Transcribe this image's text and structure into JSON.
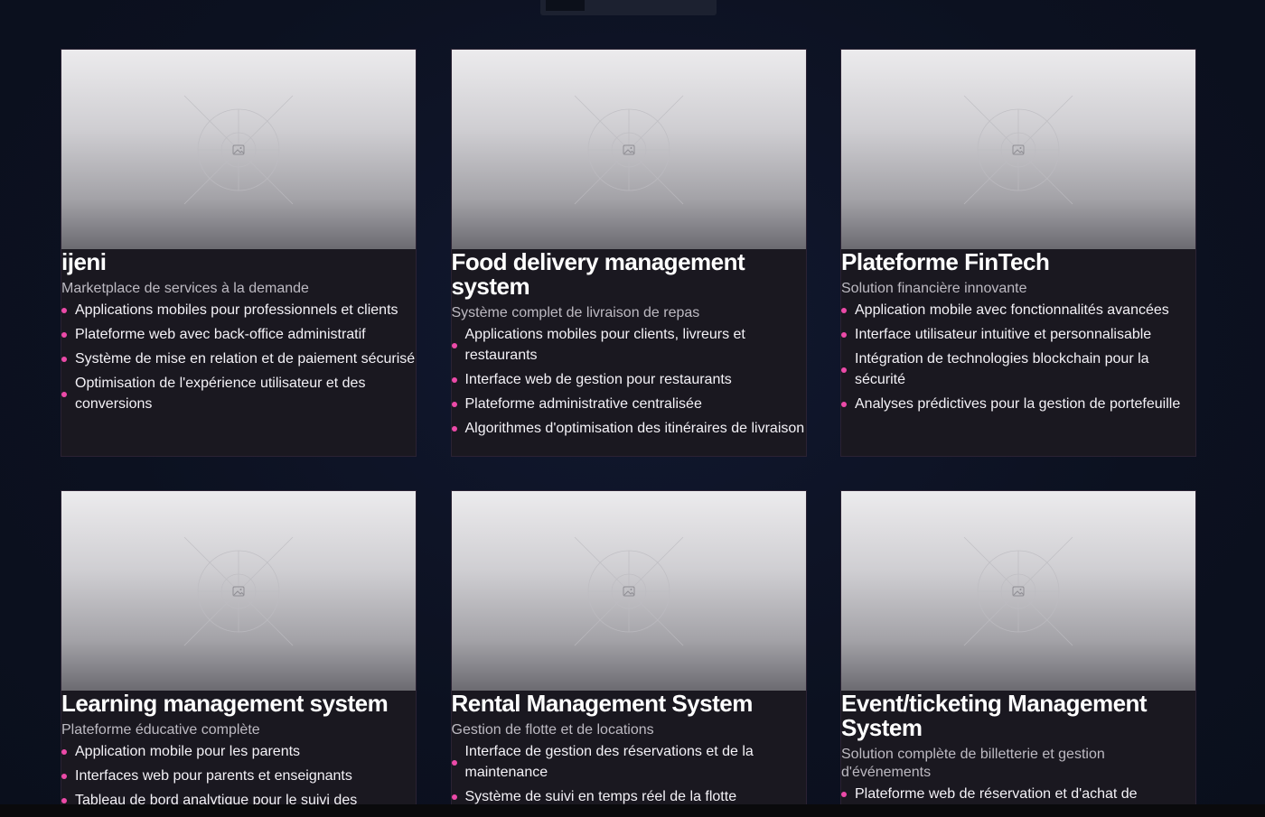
{
  "colors": {
    "background": "#0c1120",
    "card": "#1a1820",
    "accent_bullet": "#ec4aa8"
  },
  "placeholder_icon": "image-icon",
  "projects": [
    {
      "title": "ijeni",
      "subtitle": "Marketplace de services à la demande",
      "features": [
        "Applications mobiles pour professionnels et clients",
        "Plateforme web avec back-office administratif",
        "Système de mise en relation et de paiement sécurisé",
        "Optimisation de l'expérience utilisateur et des conversions"
      ]
    },
    {
      "title": "Food delivery management system",
      "subtitle": "Système complet de livraison de repas",
      "features": [
        "Applications mobiles pour clients, livreurs et restaurants",
        "Interface web de gestion pour restaurants",
        "Plateforme administrative centralisée",
        "Algorithmes d'optimisation des itinéraires de livraison"
      ]
    },
    {
      "title": "Plateforme FinTech",
      "subtitle": "Solution financière innovante",
      "features": [
        "Application mobile avec fonctionnalités avancées",
        "Interface utilisateur intuitive et personnalisable",
        "Intégration de technologies blockchain pour la sécurité",
        "Analyses prédictives pour la gestion de portefeuille"
      ]
    },
    {
      "title": "Learning management system",
      "subtitle": "Plateforme éducative complète",
      "features": [
        "Application mobile pour les parents",
        "Interfaces web pour parents et enseignants",
        "Tableau de bord analytique pour le suivi des"
      ]
    },
    {
      "title": "Rental Management System",
      "subtitle": "Gestion de flotte et de locations",
      "features": [
        "Interface de gestion des réservations et de la maintenance",
        "Système de suivi en temps réel de la flotte"
      ]
    },
    {
      "title": "Event/ticketing Management System",
      "subtitle": "Solution complète de billetterie et gestion d'événements",
      "features": [
        "Plateforme web de réservation et d'achat de"
      ]
    }
  ]
}
